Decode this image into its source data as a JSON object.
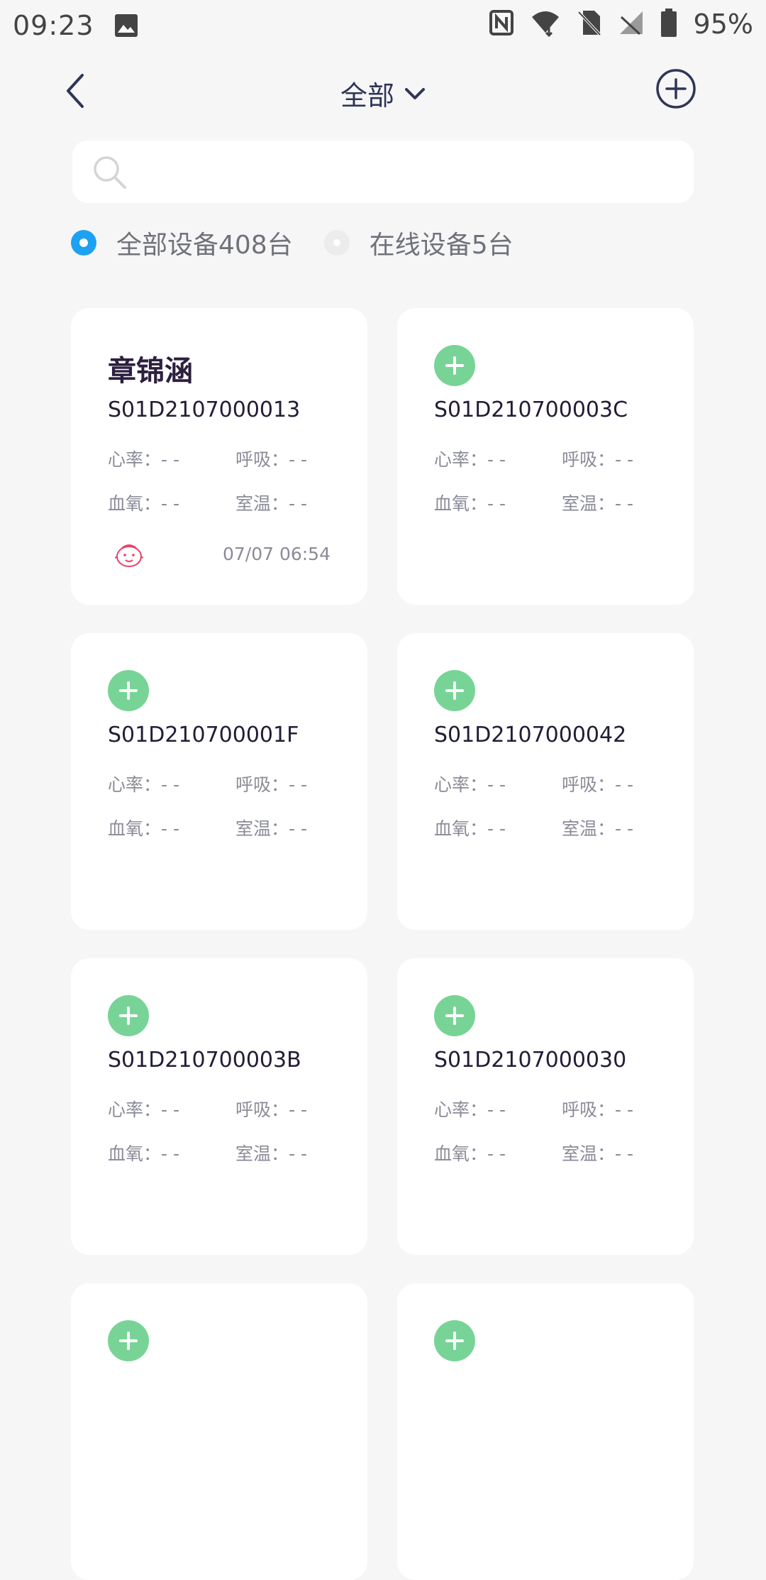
{
  "status_bar": {
    "time": "09:23",
    "battery": "95%",
    "icons": [
      "gallery-icon",
      "nfc-icon",
      "wifi-icon",
      "no-sim-icon",
      "signal-icon",
      "battery-icon"
    ]
  },
  "header": {
    "title": "全部",
    "icons": [
      "back-chevron-icon",
      "chevron-down-icon",
      "add-circle-icon"
    ]
  },
  "search": {
    "placeholder": ""
  },
  "filters": [
    {
      "label": "全部设备408台",
      "selected": true
    },
    {
      "label": "在线设备5台",
      "selected": false
    }
  ],
  "metric_labels": {
    "heart_rate": "心率：- -",
    "breathing": "呼吸：- -",
    "blood_oxygen": "血氧：- -",
    "room_temp": "室温：- -"
  },
  "devices": [
    {
      "name": "章锦涵",
      "id": "S01D2107000013",
      "time": "07/07 06:54"
    },
    {
      "id": "S01D210700003C"
    },
    {
      "id": "S01D210700001F"
    },
    {
      "id": "S01D2107000042"
    },
    {
      "id": "S01D210700003B"
    },
    {
      "id": "S01D2107000030"
    },
    {
      "id": ""
    },
    {
      "id": ""
    }
  ],
  "colors": {
    "accent_blue": "#1da1f2",
    "add_green": "#78d496",
    "background": "#f6f6f7",
    "baby_icon": "#e8406a"
  }
}
